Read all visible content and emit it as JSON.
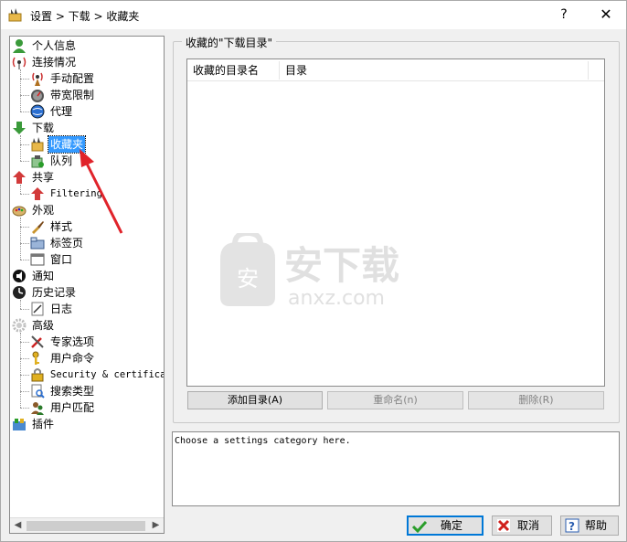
{
  "window": {
    "title": "设置 > 下载 > 收藏夹",
    "help_glyph": "?",
    "close_glyph": "✕"
  },
  "tree": {
    "items": [
      {
        "label": "个人信息",
        "icon": "person-icon",
        "indent": 0
      },
      {
        "label": "连接情况",
        "icon": "antenna-icon",
        "indent": 0
      },
      {
        "label": "手动配置",
        "icon": "antenna-small-icon",
        "indent": 1
      },
      {
        "label": "带宽限制",
        "icon": "gauge-icon",
        "indent": 1
      },
      {
        "label": "代理",
        "icon": "globe-icon",
        "indent": 1
      },
      {
        "label": "下载",
        "icon": "download-arrow-icon",
        "indent": 0
      },
      {
        "label": "收藏夹",
        "icon": "folder-star-icon",
        "indent": 1,
        "selected": true
      },
      {
        "label": "队列",
        "icon": "queue-icon",
        "indent": 1
      },
      {
        "label": "共享",
        "icon": "upload-arrow-icon",
        "indent": 0
      },
      {
        "label": "Filtering",
        "icon": "upload-arrow-icon",
        "indent": 1,
        "mono": true
      },
      {
        "label": "外观",
        "icon": "palette-icon",
        "indent": 0
      },
      {
        "label": "样式",
        "icon": "brush-icon",
        "indent": 1
      },
      {
        "label": "标签页",
        "icon": "tabs-icon",
        "indent": 1
      },
      {
        "label": "窗口",
        "icon": "window-icon",
        "indent": 1
      },
      {
        "label": "通知",
        "icon": "notify-icon",
        "indent": 0
      },
      {
        "label": "历史记录",
        "icon": "clock-icon",
        "indent": 0
      },
      {
        "label": "日志",
        "icon": "log-icon",
        "indent": 1
      },
      {
        "label": "高级",
        "icon": "gear-icon",
        "indent": 0
      },
      {
        "label": "专家选项",
        "icon": "tools-icon",
        "indent": 1
      },
      {
        "label": "用户命令",
        "icon": "key-icon",
        "indent": 1
      },
      {
        "label": "Security & certificates",
        "icon": "lock-icon",
        "indent": 1,
        "mono": true
      },
      {
        "label": "搜索类型",
        "icon": "search-icon",
        "indent": 1
      },
      {
        "label": "用户匹配",
        "icon": "users-icon",
        "indent": 1
      },
      {
        "label": "插件",
        "icon": "plugin-icon",
        "indent": 0
      }
    ]
  },
  "favorites": {
    "group_title": "收藏的\"下载目录\"",
    "columns": [
      "收藏的目录名",
      "目录"
    ],
    "add_label": "添加目录(A)",
    "rename_label": "重命名(n)",
    "delete_label": "删除(R)"
  },
  "info": {
    "text": "Choose a settings category here."
  },
  "footer": {
    "ok_label": "确定",
    "cancel_label": "取消",
    "help_label": "帮助"
  },
  "watermark": {
    "main": "安下载",
    "sub": "anxz.com",
    "badge": "安"
  },
  "colors": {
    "selection": "#3399ff",
    "focus_border": "#0078d7",
    "arrow": "#e0232a"
  }
}
